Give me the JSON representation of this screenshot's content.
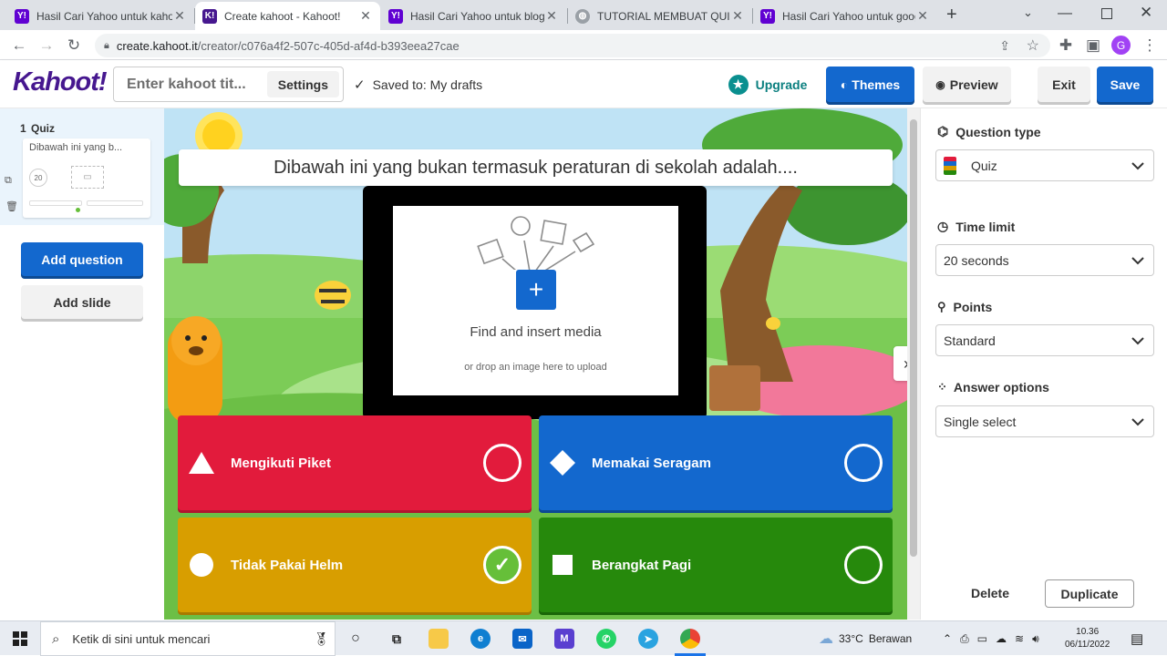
{
  "browser": {
    "tabs": [
      {
        "title": "Hasil Cari Yahoo untuk kahoot",
        "favicon": "yahoo-icon",
        "active": false
      },
      {
        "title": "Create kahoot - Kahoot!",
        "favicon": "kahoot-icon",
        "active": true
      },
      {
        "title": "Hasil Cari Yahoo untuk blog c",
        "favicon": "yahoo-icon",
        "active": false
      },
      {
        "title": "TUTORIAL MEMBUAT QUIS C",
        "favicon": "globe-icon",
        "active": false
      },
      {
        "title": "Hasil Cari Yahoo untuk goog",
        "favicon": "yahoo-icon",
        "active": false
      }
    ],
    "url_host": "create.kahoot.it",
    "url_path": "/creator/c076a4f2-507c-405d-af4d-b393eea27cae",
    "profile_initial": "G"
  },
  "header": {
    "logo": "Kahoot!",
    "title_placeholder": "Enter kahoot tit...",
    "settings_label": "Settings",
    "saved_text": "Saved to: My drafts",
    "upgrade_label": "Upgrade",
    "themes_label": "Themes",
    "preview_label": "Preview",
    "exit_label": "Exit",
    "save_label": "Save"
  },
  "sidebar": {
    "slide_number": "1",
    "slide_type": "Quiz",
    "slide_preview_text": "Dibawah ini yang b...",
    "slide_time": "20",
    "add_question_label": "Add question",
    "add_slide_label": "Add slide"
  },
  "editor": {
    "question": "Dibawah ini yang bukan termasuk peraturan di sekolah adalah....",
    "media_title": "Find and insert media",
    "media_subtitle": "or drop an image here to upload",
    "answers": [
      {
        "text": "Mengikuti Piket",
        "shape": "triangle",
        "color": "#e21b3c",
        "correct": false
      },
      {
        "text": "Memakai Seragam",
        "shape": "diamond",
        "color": "#1368ce",
        "correct": false
      },
      {
        "text": "Tidak Pakai Helm",
        "shape": "circle",
        "color": "#d89e00",
        "correct": true
      },
      {
        "text": "Berangkat Pagi",
        "shape": "square",
        "color": "#26890c",
        "correct": false
      }
    ]
  },
  "panel": {
    "question_type_label": "Question type",
    "question_type_value": "Quiz",
    "time_limit_label": "Time limit",
    "time_limit_value": "20 seconds",
    "points_label": "Points",
    "points_value": "Standard",
    "answer_options_label": "Answer options",
    "answer_options_value": "Single select",
    "delete_label": "Delete",
    "duplicate_label": "Duplicate"
  },
  "taskbar": {
    "search_placeholder": "Ketik di sini untuk mencari",
    "weather_temp": "33°C",
    "weather_desc": "Berawan",
    "time": "10.36",
    "date": "06/11/2022"
  },
  "colors": {
    "kahoot_purple": "#46178f",
    "kahoot_blue": "#1368ce",
    "upgrade_teal": "#0aa3a3"
  }
}
